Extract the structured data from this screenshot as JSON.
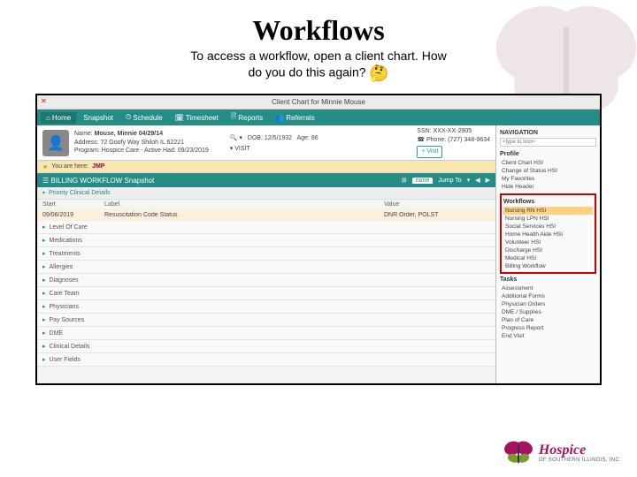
{
  "slide": {
    "title": "Workflows",
    "subtitle_1": "To access a workflow, open a client chart. How",
    "subtitle_2": "do you do this again?",
    "emoji": "🤔"
  },
  "window": {
    "title": "Client Chart for Minnie Mouse"
  },
  "nav": {
    "home": "Home",
    "snapshot": "Snapshot",
    "schedule": "Schedule",
    "timesheet": "Timesheet",
    "reports": "Reports",
    "referrals": "Referrals"
  },
  "client": {
    "name_label": "Name:",
    "name": "Mouse, Minnie  04/29/14",
    "address_label": "Address:",
    "address": "72 Goofy Way Shiloh IL 62221",
    "program_label": "Program:",
    "program": "Hospice Care - Active Had: 09/23/2019",
    "dob_label": "DOB:",
    "dob": "12/5/1932",
    "age_label": "Age:",
    "age": "86",
    "ssn_label": "SSN:",
    "ssn": "XXX-XX-2905",
    "phone_icon": "☎",
    "phone_label": "Phone:",
    "phone": "(727) 348-9634",
    "visit": "VISIT",
    "add_visit": "+ Visit"
  },
  "crumb": {
    "you_are_here": "You are here:",
    "jmp": "JMP"
  },
  "workflow": {
    "bar_label": "BILLING WORKFLOW  Snapshot",
    "none": "none",
    "jump_to": "Jump To"
  },
  "priority": {
    "header": "Priority Clinical Details",
    "col_start": "Start",
    "col_label": "Label",
    "col_value": "Value",
    "row_date": "09/06/2019",
    "row_label": "Resuscitation Code Status",
    "row_value": "DNR Order, POLST"
  },
  "accordion": {
    "items": [
      "Level Of Care",
      "Medications",
      "Treatments",
      "Allergies",
      "Diagnoses",
      "Care Team",
      "Physicians",
      "Pay Sources",
      "DME",
      "Clinical Details",
      "User Fields"
    ]
  },
  "sidebar": {
    "nav_title": "NAVIGATION",
    "search_ph": "<type to find>",
    "profile_title": "Profile",
    "profile_items": [
      "Client Chart HSI",
      "Change of Status HSI",
      "My Favorites",
      "Hide Header"
    ],
    "workflows_title": "Workflows",
    "workflow_items": [
      "Nursing RN HSI",
      "Nursing LPN HSI",
      "Social Services HSI",
      "Home Health Aide HSI",
      "Volunteer HSI",
      "Discharge HSI",
      "Medical HSI",
      "Billing Workflow"
    ],
    "tasks_title": "Tasks",
    "task_items": [
      "Assessment",
      "Additional Forms",
      "Physician Orders",
      "DME / Supplies",
      "Plan of Care",
      "Progress Report",
      "End Visit"
    ]
  },
  "footer": {
    "brand": "Hospice",
    "tagline": "OF SOUTHERN ILLINOIS, INC."
  }
}
